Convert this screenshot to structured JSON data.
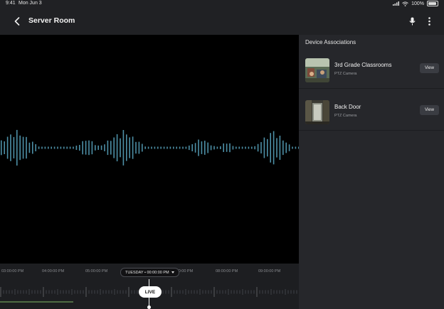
{
  "status_bar": {
    "time": "9:41",
    "date": "Mon Jun 3",
    "battery": "100%"
  },
  "header": {
    "title": "Server Room"
  },
  "timeline": {
    "labels": [
      "03:00:00 PM",
      "04:00:00 PM",
      "05:00:00 PM",
      "06:00:00 PM",
      "08:00:00 PM",
      "09:00:00 PM"
    ],
    "selected_date": "TUESDAY • 00:00:00 PM",
    "live_label": "LIVE"
  },
  "panel": {
    "title": "Device Associations",
    "devices": [
      {
        "name": "3rd Grade Classrooms",
        "type": "PTZ Camera",
        "button": "View"
      },
      {
        "name": "Back Door",
        "type": "PTZ Camera",
        "button": "View"
      }
    ]
  },
  "colors": {
    "waveform": "#4d8fa6",
    "background": "#202124",
    "panel": "#26272b"
  }
}
